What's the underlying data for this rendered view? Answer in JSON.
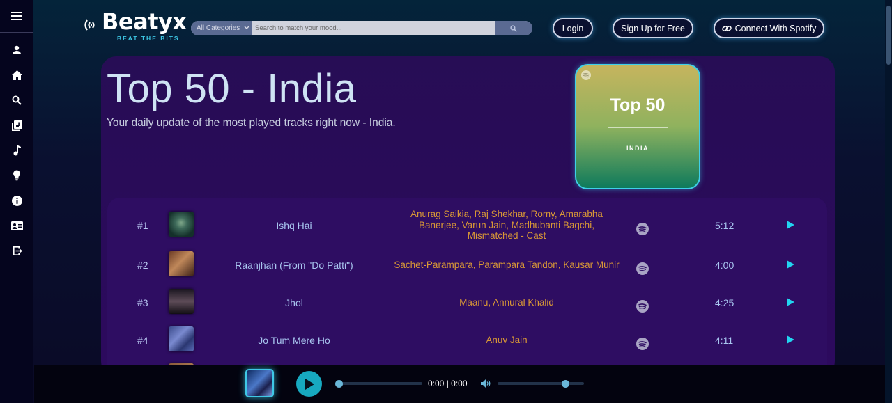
{
  "app": {
    "name": "Beatyx",
    "tagline": "BEAT THE BITS"
  },
  "sidebar": {
    "items": [
      {
        "name": "profile-icon"
      },
      {
        "name": "home-icon"
      },
      {
        "name": "search-icon"
      },
      {
        "name": "library-icon"
      },
      {
        "name": "music-note-icon"
      },
      {
        "name": "lightbulb-icon"
      },
      {
        "name": "info-icon"
      },
      {
        "name": "contact-card-icon"
      },
      {
        "name": "logout-icon"
      }
    ]
  },
  "search": {
    "category": "All Categories",
    "placeholder": "Search to match your mood..."
  },
  "header": {
    "login_label": "Login",
    "signup_label": "Sign Up for Free",
    "spotify_label": "Connect With Spotify"
  },
  "playlist": {
    "title": "Top 50 - India",
    "subtitle": "Your daily update of the most played tracks right now - India.",
    "cover_title": "Top 50",
    "cover_subtitle": "INDIA"
  },
  "tracks": [
    {
      "rank": "#1",
      "title": "Ishq Hai",
      "artists": [
        "Anurag Saikia, Raj Shekhar, Romy, Amarabha",
        "Banerjee, Varun Jain, Madhubanti Bagchi,",
        "Mismatched - Cast"
      ],
      "duration": "5:12"
    },
    {
      "rank": "#2",
      "title": "Raanjhan (From \"Do Patti\")",
      "artists": [
        "Sachet-Parampara, Parampara Tandon, Kausar Munir"
      ],
      "duration": "4:00"
    },
    {
      "rank": "#3",
      "title": "Jhol",
      "artists": [
        "Maanu, Annural Khalid"
      ],
      "duration": "4:25"
    },
    {
      "rank": "#4",
      "title": "Jo Tum Mere Ho",
      "artists": [
        "Anuv Jain"
      ],
      "duration": "4:11"
    }
  ],
  "player": {
    "current_time": "0:00",
    "total_time": "0:00",
    "time_display": "0:00 | 0:00",
    "progress": 0,
    "volume": 0.78
  },
  "colors": {
    "accent": "#3fd0e8",
    "artist_text": "#d99836",
    "panel": "#2a0b5a"
  }
}
